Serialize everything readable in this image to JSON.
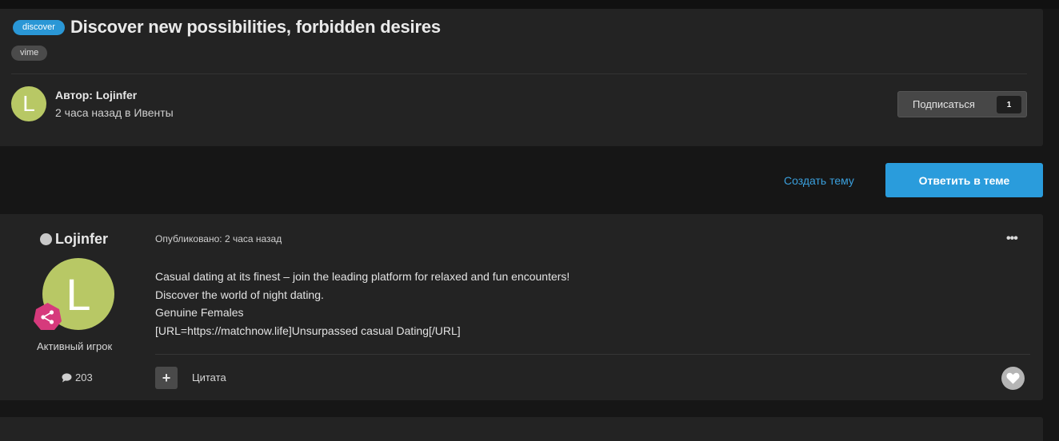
{
  "header": {
    "prefix_badge": "discover",
    "title": "Discover new possibilities, forbidden desires",
    "tag": "vime",
    "author_initial": "L",
    "author_line": "Автор: Lojinfer",
    "author_sub": "2 часа назад в Ивенты",
    "follow_label": "Подписаться",
    "follow_count": "1"
  },
  "actions": {
    "create_topic": "Создать тему",
    "reply": "Ответить в теме"
  },
  "post": {
    "author": "Lojinfer",
    "avatar_initial": "L",
    "rank": "Активный игрок",
    "post_count": "203",
    "meta": "Опубликовано: 2 часа назад",
    "menu": "•••",
    "body": [
      "Casual dating at its finest – join the leading platform for relaxed and fun encounters!",
      "Discover the world of night dating.",
      "Genuine Females",
      "[URL=https://matchnow.life]Unsurpassed casual Dating[/URL]"
    ],
    "plus": "+",
    "quote": "Цитата"
  },
  "colors": {
    "accent": "#2a9cdc",
    "avatar_bg": "#b8c865",
    "rank_badge": "#d63a7c",
    "card_bg": "#232323",
    "page_bg": "#161616"
  },
  "icons": [
    "share-icon",
    "speech-bubble-icon",
    "heart-icon",
    "more-icon"
  ]
}
